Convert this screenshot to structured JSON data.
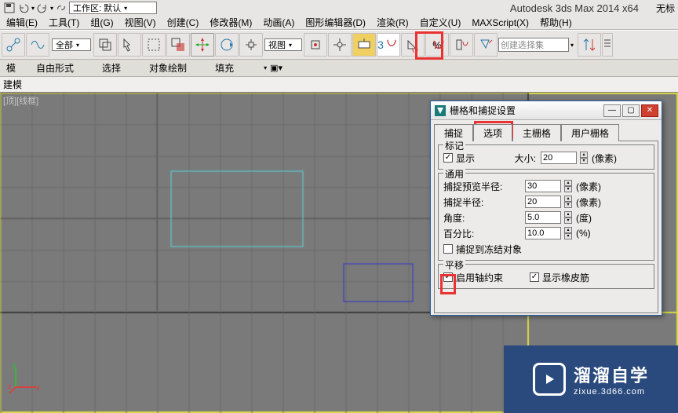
{
  "header": {
    "workspace_label": "工作区: 默认",
    "app_title": "Autodesk 3ds Max  2014 x64",
    "right_text": "无标"
  },
  "menus": {
    "edit": "编辑(E)",
    "tool": "工具(T)",
    "group": "组(G)",
    "view": "视图(V)",
    "create": "创建(C)",
    "modifier": "修改器(M)",
    "anim": "动画(A)",
    "graph": "图形编辑器(D)",
    "render": "渲染(R)",
    "custom": "自定义(U)",
    "script": "MAXScript(X)",
    "help": "帮助(H)"
  },
  "toolbar": {
    "all": "全部",
    "view_mode": "视图",
    "snap3": "3",
    "sel_set": "创建选择集"
  },
  "ribbon": {
    "mode": "模",
    "free": "自由形式",
    "select": "选择",
    "paint": "对象绘制",
    "fill": "填充"
  },
  "subbar": {
    "label": "建模"
  },
  "viewport": {
    "label": "[顶][线框]"
  },
  "dialog": {
    "title": "栅格和捕捉设置",
    "tabs": {
      "snap": "捕捉",
      "options": "选项",
      "maingrid": "主栅格",
      "usergrid": "用户栅格"
    },
    "mark_group": "标记",
    "show": "显示",
    "size": "大小:",
    "size_val": "20",
    "pixel": "(像素)",
    "general_group": "通用",
    "snap_preview": "捕捉预览半径:",
    "snap_preview_val": "30",
    "snap_radius": "捕捉半径:",
    "snap_radius_val": "20",
    "angle": "角度:",
    "angle_val": "5.0",
    "deg": "(度)",
    "percent": "百分比:",
    "percent_val": "10.0",
    "pct": "(%)",
    "freeze": "捕捉到冻结对象",
    "translate_group": "平移",
    "axis_constraint": "启用轴约束",
    "rubber_band": "显示橡皮筋"
  },
  "logo": {
    "big": "溜溜自学",
    "small": "zixue.3d66.com"
  }
}
